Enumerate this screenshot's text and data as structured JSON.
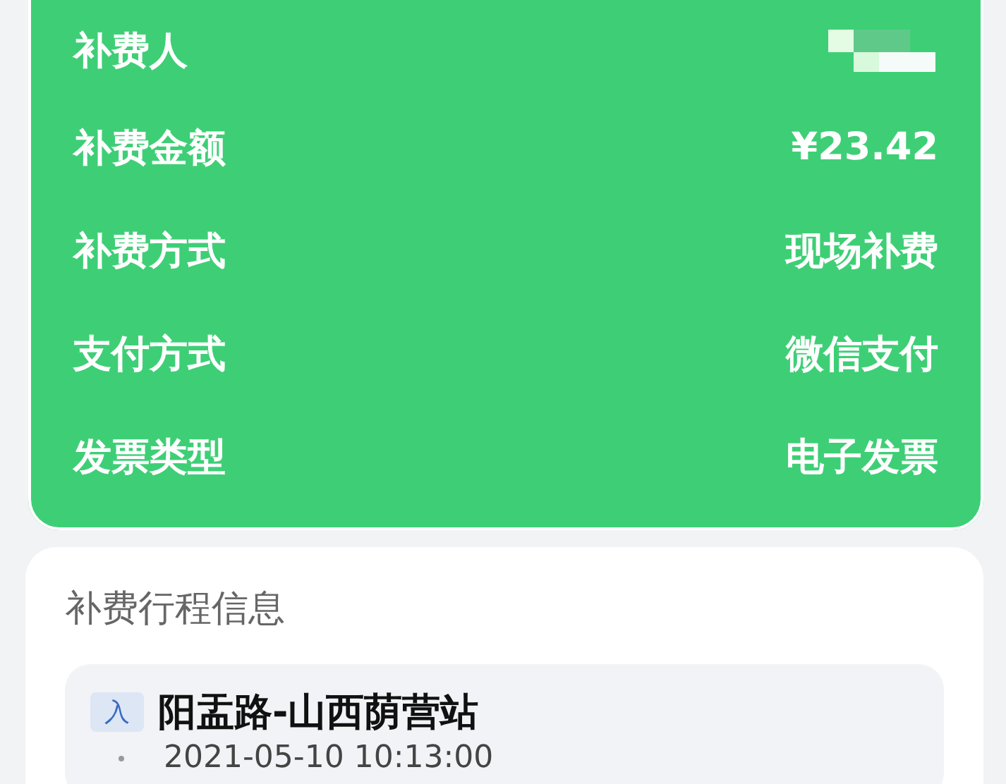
{
  "summary": {
    "rows": [
      {
        "label": "补费人",
        "kind": "redacted"
      },
      {
        "label": "补费金额",
        "kind": "text",
        "value": "¥23.42"
      },
      {
        "label": "补费方式",
        "kind": "text",
        "value": "现场补费"
      },
      {
        "label": "支付方式",
        "kind": "text",
        "value": "微信支付"
      },
      {
        "label": "发票类型",
        "kind": "text",
        "value": "电子发票"
      }
    ]
  },
  "trip": {
    "title": "补费行程信息",
    "stops": [
      {
        "badge": "入",
        "station": "阳盂路-山西荫营站",
        "time": "2021-05-10 10:13:00"
      }
    ]
  }
}
